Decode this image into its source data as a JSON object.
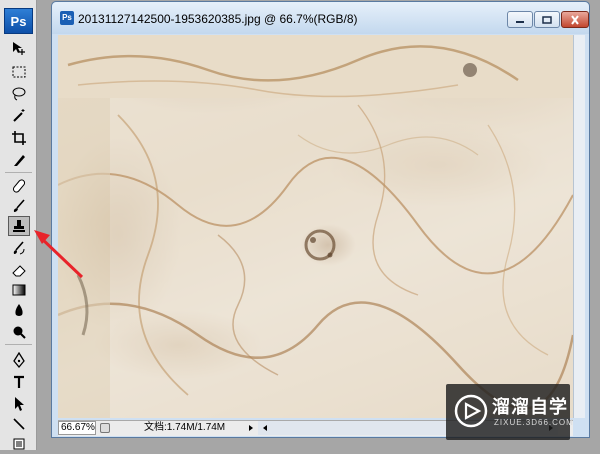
{
  "app": {
    "logo_text": "Ps"
  },
  "toolbox": {
    "tools": [
      {
        "name": "move-tool",
        "icon": "move-icon"
      },
      {
        "name": "marquee-tool",
        "icon": "rect-marquee-icon"
      },
      {
        "name": "lasso-tool",
        "icon": "lasso-icon"
      },
      {
        "name": "magic-wand-tool",
        "icon": "magic-wand-icon"
      },
      {
        "name": "crop-tool",
        "icon": "crop-icon"
      },
      {
        "name": "slice-tool",
        "icon": "slice-icon"
      },
      {
        "name": "healing-brush-tool",
        "icon": "bandage-icon"
      },
      {
        "name": "brush-tool",
        "icon": "brush-icon"
      },
      {
        "name": "clone-stamp-tool",
        "icon": "stamp-icon",
        "selected": true
      },
      {
        "name": "history-brush-tool",
        "icon": "history-brush-icon"
      },
      {
        "name": "eraser-tool",
        "icon": "eraser-icon"
      },
      {
        "name": "gradient-tool",
        "icon": "gradient-icon"
      },
      {
        "name": "blur-tool",
        "icon": "drop-icon"
      },
      {
        "name": "dodge-tool",
        "icon": "dodge-icon"
      },
      {
        "name": "pen-tool",
        "icon": "pen-icon"
      },
      {
        "name": "type-tool",
        "icon": "type-icon"
      },
      {
        "name": "path-selection-tool",
        "icon": "arrow-icon"
      },
      {
        "name": "line-tool",
        "icon": "line-icon"
      },
      {
        "name": "notes-tool",
        "icon": "notes-icon"
      }
    ]
  },
  "document": {
    "title": "20131127142500-1953620385.jpg @ 66.7%(RGB/8)",
    "zoom": "66.67%",
    "doc_info": "文档:1.74M/1.74M"
  },
  "window_controls": {
    "minimize_icon": "minimize-icon",
    "restore_icon": "restore-icon",
    "close_icon": "close-icon"
  },
  "annotation": {
    "color": "#e8232a"
  },
  "watermark": {
    "brand": "溜溜自学",
    "url": "ZIXUE.3D66.COM"
  },
  "colors": {
    "title_bar": "#c3d8ee",
    "selected_tool": "#bdbdbd",
    "watermark_bg": "#1e1e1e"
  }
}
